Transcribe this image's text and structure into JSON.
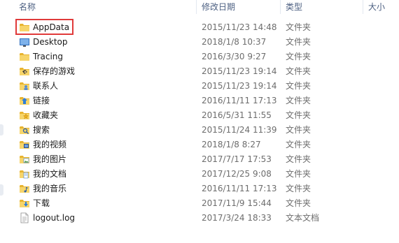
{
  "columns": {
    "name": "名称",
    "modified": "修改日期",
    "type": "类型",
    "size": "大小"
  },
  "items": [
    {
      "name": "AppData",
      "date": "2015/11/23 14:48",
      "type": "文件夹",
      "icon": "folder-icon"
    },
    {
      "name": "Desktop",
      "date": "2018/1/8 10:37",
      "type": "文件夹",
      "icon": "desktop-folder-icon"
    },
    {
      "name": "Tracing",
      "date": "2016/3/30 9:27",
      "type": "文件夹",
      "icon": "folder-icon"
    },
    {
      "name": "保存的游戏",
      "date": "2015/11/23 19:14",
      "type": "文件夹",
      "icon": "saved-games-folder-icon"
    },
    {
      "name": "联系人",
      "date": "2015/11/23 19:14",
      "type": "文件夹",
      "icon": "contacts-folder-icon"
    },
    {
      "name": "链接",
      "date": "2016/11/11 17:13",
      "type": "文件夹",
      "icon": "links-folder-icon"
    },
    {
      "name": "收藏夹",
      "date": "2016/5/31 11:55",
      "type": "文件夹",
      "icon": "favorites-folder-icon"
    },
    {
      "name": "搜索",
      "date": "2015/11/24 11:39",
      "type": "文件夹",
      "icon": "searches-folder-icon"
    },
    {
      "name": "我的视频",
      "date": "2018/1/8 8:27",
      "type": "文件夹",
      "icon": "videos-folder-icon"
    },
    {
      "name": "我的图片",
      "date": "2017/7/17 17:53",
      "type": "文件夹",
      "icon": "pictures-folder-icon"
    },
    {
      "name": "我的文档",
      "date": "2017/12/25 9:08",
      "type": "文件夹",
      "icon": "documents-folder-icon"
    },
    {
      "name": "我的音乐",
      "date": "2016/11/11 17:13",
      "type": "文件夹",
      "icon": "music-folder-icon"
    },
    {
      "name": "下载",
      "date": "2017/11/9 15:44",
      "type": "文件夹",
      "icon": "downloads-folder-icon"
    },
    {
      "name": "logout.log",
      "date": "2017/3/24 18:33",
      "type": "文本文档",
      "icon": "text-file-icon"
    }
  ],
  "colors": {
    "highlight": "#e03a3a",
    "folder": "#f3c74a",
    "header_text": "#4d6082"
  }
}
